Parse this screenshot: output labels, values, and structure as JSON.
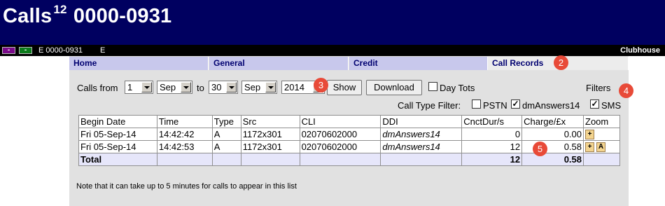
{
  "header": {
    "title_prefix": "Calls",
    "title_super": "12",
    "title_number": "0000-0931"
  },
  "statusbar": {
    "minus_label": "-",
    "account": "E 0000-0931",
    "flag": "E",
    "right_label": "Clubhouse"
  },
  "tabs": [
    {
      "label": "Home"
    },
    {
      "label": "General"
    },
    {
      "label": "Credit"
    },
    {
      "label": "Call Records"
    }
  ],
  "controls": {
    "calls_from_label": "Calls from",
    "from_day": "1",
    "from_month": "Sep",
    "to_label": "to",
    "to_day": "30",
    "to_month": "Sep",
    "year": "2014",
    "show_label": "Show",
    "download_label": "Download",
    "day_tots_label": "Day Tots",
    "day_tots_checked": false,
    "filters_label": "Filters",
    "call_type_filter_label": "Call Type Filter:",
    "pstn_label": "PSTN",
    "pstn_checked": false,
    "dmanswers_label": "dmAnswers14",
    "dmanswers_checked": true,
    "sms_label": "SMS",
    "sms_checked": true,
    "check_mark": "✓"
  },
  "annotations": [
    "2",
    "3",
    "4",
    "5"
  ],
  "table": {
    "headers": [
      "Begin Date",
      "Time",
      "Type",
      "Src",
      "CLI",
      "DDI",
      "CnctDur/s",
      "Charge/£x",
      "Zoom"
    ],
    "rows": [
      {
        "date": "Fri 05-Sep-14",
        "time": "14:42:42",
        "type": "A",
        "src": "1172x301",
        "cli": "02070602000",
        "ddi": "dmAnswers14",
        "dur": "0",
        "charge": "0.00",
        "zoom": [
          "+"
        ]
      },
      {
        "date": "Fri 05-Sep-14",
        "time": "14:42:53",
        "type": "A",
        "src": "1172x301",
        "cli": "02070602000",
        "ddi": "dmAnswers14",
        "dur": "12",
        "charge": "0.58",
        "zoom": [
          "+",
          "A"
        ]
      }
    ],
    "total": {
      "label": "Total",
      "dur": "12",
      "charge": "0.58"
    }
  },
  "note": "Note that it can take up to 5 minutes for calls to appear in this list",
  "colors": {
    "header_bg": "#000060",
    "tab_bg": "#c8c8ec",
    "content_bg": "#e1e1e1",
    "badge": "#e84a38",
    "total_row_bg": "#e6e6fa"
  }
}
